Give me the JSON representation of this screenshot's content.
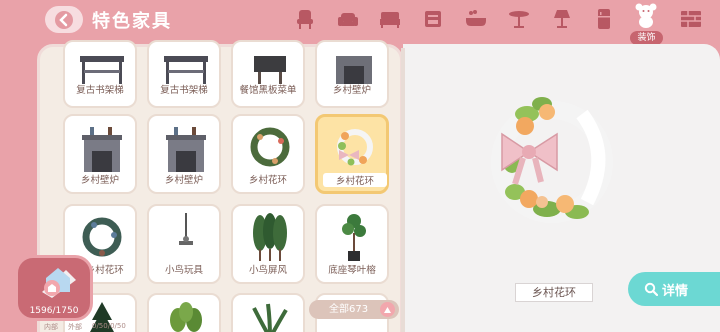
{
  "header": {
    "title": "特色家具",
    "active_category_label": "装饰",
    "categories": [
      "chair-icon",
      "sofa-icon",
      "bed-icon",
      "cabinet-icon",
      "bathtub-icon",
      "table-icon",
      "lamp-icon",
      "fridge-icon",
      "decor-bear-icon",
      "wall-brick-icon"
    ]
  },
  "grid": {
    "row1": [
      "复古书架梯",
      "复古书架梯",
      "餐馆黑板菜单",
      "乡村壁炉"
    ],
    "row2": [
      "乡村壁炉",
      "乡村壁炉",
      "乡村花环",
      "乡村花环"
    ],
    "row3": [
      "冬乡村花环",
      "小鸟玩具",
      "小鸟屏风",
      "底座琴叶榕"
    ]
  },
  "count": {
    "label": "全部673"
  },
  "preview": {
    "name": "乡村花环",
    "detail_label": "详情"
  },
  "storage": {
    "value": "1596/1750"
  },
  "footer": {
    "left": "内部",
    "mid": "外部",
    "right": "0/50/0/50"
  },
  "colors": {
    "accent": "#e9a2a9",
    "selected": "#fde3a5",
    "detail": "#6cd8d3"
  }
}
